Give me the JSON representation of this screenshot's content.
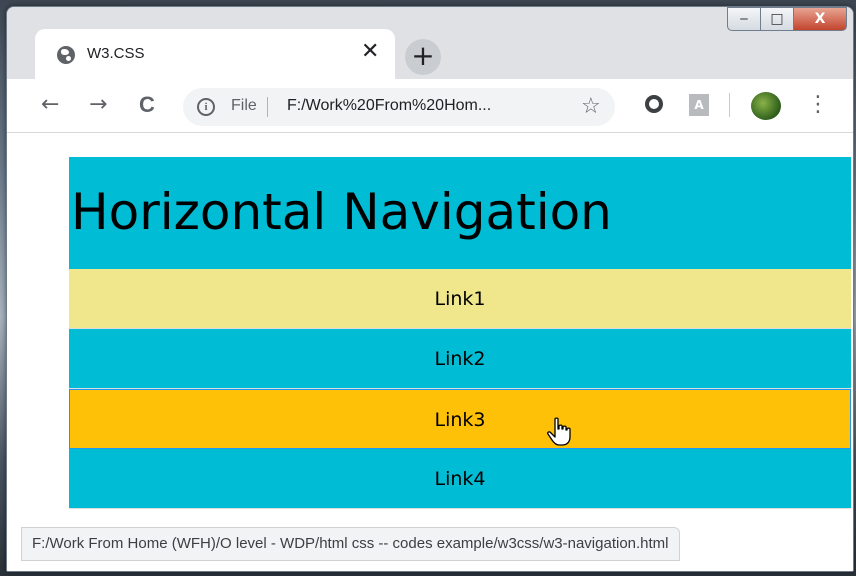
{
  "window": {
    "controls": {
      "minimize": "‒",
      "maximize": "□",
      "close": "X"
    }
  },
  "tab": {
    "title": "W3.CSS",
    "close_glyph": "✕",
    "icon": "globe-icon"
  },
  "new_tab_glyph": "+",
  "toolbar": {
    "back_glyph": "←",
    "forward_glyph": "→",
    "reload_glyph": "C",
    "info_glyph": "i",
    "file_label": "File",
    "url": "F:/Work%20From%20Hom...",
    "star_glyph": "☆",
    "pdf_glyph": "A",
    "menu_glyph": "⋮"
  },
  "page": {
    "heading": "Horizontal Navigation",
    "links": [
      {
        "label": "Link1",
        "color": "#f0e68c"
      },
      {
        "label": "Link2",
        "color": "#00bcd4"
      },
      {
        "label": "Link3",
        "color": "#ffc107"
      },
      {
        "label": "Link4",
        "color": "#00bcd4"
      }
    ],
    "header_color": "#00bcd4"
  },
  "status_bar": {
    "text": "F:/Work From Home (WFH)/O level - WDP/html css -- codes example/w3css/w3-navigation.html"
  }
}
